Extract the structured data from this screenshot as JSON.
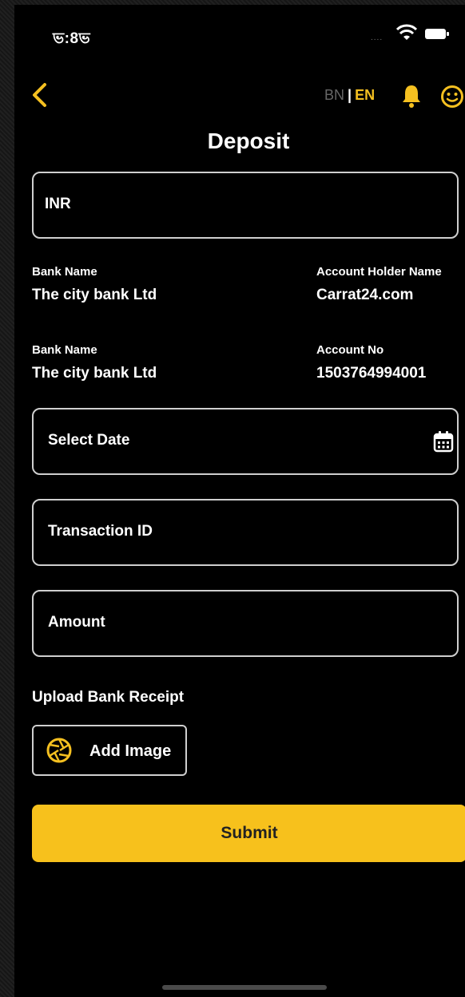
{
  "status_bar": {
    "time": "ভ:8ভ",
    "signal_dots": "....",
    "wifi_icon": "wifi-icon",
    "battery_icon": "battery-icon"
  },
  "header": {
    "back_icon": "chevron-left-icon",
    "lang_bn": "BN",
    "lang_separator": "|",
    "lang_en": "EN",
    "bell_icon": "bell-icon",
    "profile_icon": "smiley-icon",
    "title": "Deposit"
  },
  "form": {
    "currency": "INR",
    "bank_info": [
      {
        "label": "Bank Name",
        "value": "The city bank Ltd"
      },
      {
        "label": "Account Holder Name",
        "value": "Carrat24.com"
      },
      {
        "label": "Bank Name",
        "value": "The city bank Ltd"
      },
      {
        "label": "Account No",
        "value": "1503764994001"
      }
    ],
    "date_placeholder": "Select Date",
    "calendar_icon": "calendar-icon",
    "transaction_placeholder": "Transaction ID",
    "amount_placeholder": "Amount",
    "upload_label": "Upload Bank Receipt",
    "add_image_label": "Add Image",
    "add_image_icon": "aperture-icon",
    "submit_label": "Submit"
  },
  "colors": {
    "accent": "#f7c11c",
    "background": "#000000",
    "border": "#cfcfcf",
    "text": "#ffffff",
    "muted": "#666666"
  }
}
